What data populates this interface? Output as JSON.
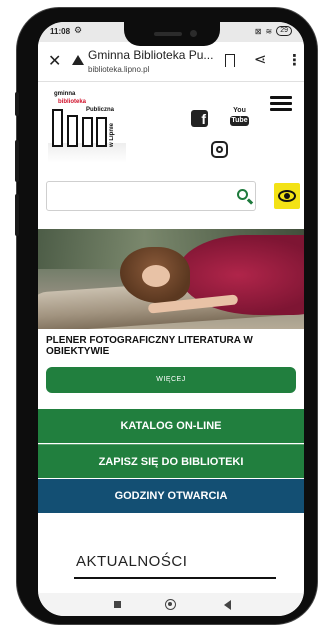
{
  "status_bar": {
    "time": "11:08",
    "battery": "29"
  },
  "browser": {
    "page_title": "Gminna Biblioteka Pu...",
    "domain": "biblioteka.lipno.pl",
    "icons": [
      "close-icon",
      "warning-icon",
      "bookmark-icon",
      "share-icon",
      "more-icon"
    ]
  },
  "header": {
    "logo": {
      "line1": "gminna",
      "line2": "biblioteka",
      "line3": "Publiczna",
      "vertical": "w Lipnie"
    },
    "social": {
      "facebook": "f",
      "youtube_top": "You",
      "youtube_bottom": "Tube"
    }
  },
  "search": {
    "value": "",
    "placeholder": ""
  },
  "feature": {
    "headline": "PLENER FOTOGRAFICZNY LITERATURA W OBIEKTYWIE",
    "more_label": "WIĘCEJ"
  },
  "nav_buttons": [
    {
      "label": "KATALOG ON-LINE",
      "color": "#217f3e"
    },
    {
      "label": "ZAPISZ SIĘ DO BIBLIOTEKI",
      "color": "#217f3e"
    },
    {
      "label": "GODZINY OTWARCIA",
      "color": "#134f73"
    }
  ],
  "news": {
    "title": "AKTUALNOŚCI"
  },
  "colors": {
    "accent_green": "#217f3e",
    "accent_blue": "#134f73",
    "accessibility_yellow": "#f3e216"
  }
}
